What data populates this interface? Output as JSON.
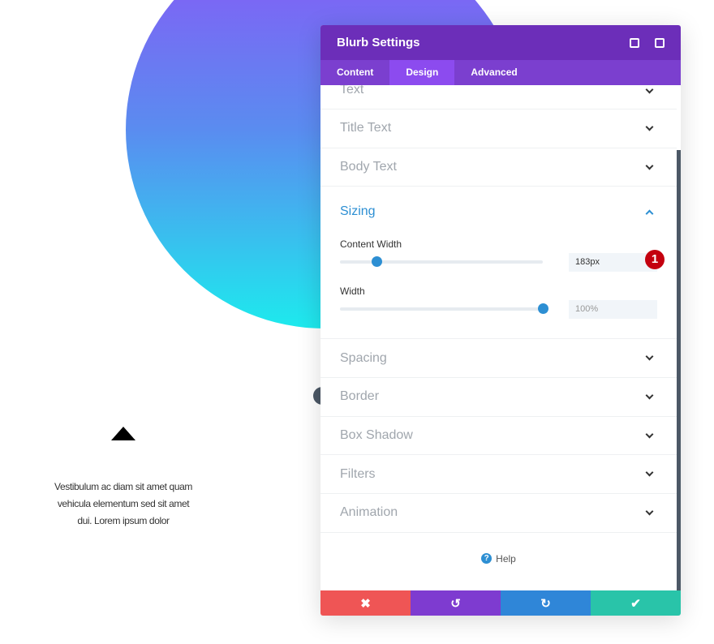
{
  "page": {
    "blurb_text": "Vestibulum ac diam sit amet quam vehicula elementum sed sit amet dui. Lorem ipsum dolor",
    "blurb_icon": "caret-up-icon"
  },
  "panel": {
    "title": "Blurb Settings",
    "tabs": [
      {
        "label": "Content"
      },
      {
        "label": "Design",
        "active": true
      },
      {
        "label": "Advanced"
      }
    ],
    "sections_top": [
      {
        "label": "Text"
      },
      {
        "label": "Title Text"
      },
      {
        "label": "Body Text"
      }
    ],
    "sizing": {
      "label": "Sizing",
      "content_width": {
        "label": "Content Width",
        "value": "183px",
        "slider_percent": 18
      },
      "width": {
        "label": "Width",
        "value": "100%",
        "slider_percent": 100
      },
      "annotation": "1"
    },
    "sections_bottom": [
      {
        "label": "Spacing"
      },
      {
        "label": "Border"
      },
      {
        "label": "Box Shadow"
      },
      {
        "label": "Filters"
      },
      {
        "label": "Animation"
      }
    ],
    "help": "Help",
    "footer": {
      "cancel": "✖",
      "undo": "↺",
      "redo": "↻",
      "save": "✔"
    },
    "colors": {
      "header": "#6c2eb9",
      "tabs": "#7b3fcf",
      "active_tab": "#8c4bef",
      "cancel": "#ef5555",
      "undo": "#7e3bd0",
      "redo": "#2f86d8",
      "save": "#29c4a9",
      "accent": "#2d8fd3"
    }
  }
}
